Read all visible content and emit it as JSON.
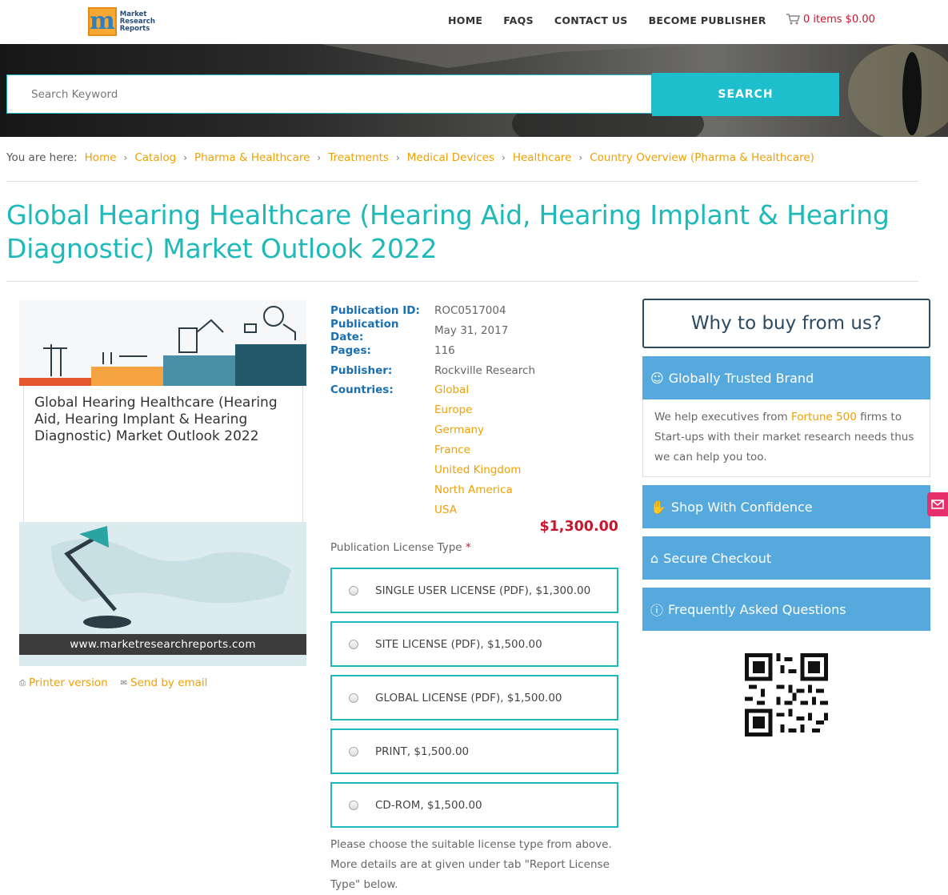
{
  "header": {
    "logo_text": [
      "Market",
      "Research",
      "Reports"
    ],
    "logo_letter": "m",
    "nav": [
      "HOME",
      "FAQS",
      "CONTACT US",
      "BECOME PUBLISHER"
    ],
    "cart": "0 items $0.00"
  },
  "search": {
    "placeholder": "Search Keyword",
    "button": "SEARCH"
  },
  "breadcrumb": {
    "prefix": "You are here:",
    "items": [
      "Home",
      "Catalog",
      "Pharma & Healthcare",
      "Treatments",
      "Medical Devices",
      "Healthcare",
      "Country Overview (Pharma & Healthcare)"
    ]
  },
  "title": "Global Hearing Healthcare (Hearing Aid, Hearing Implant & Hearing Diagnostic) Market Outlook 2022",
  "cover": {
    "title": "Global Hearing Healthcare (Hearing Aid, Hearing Implant & Hearing Diagnostic) Market Outlook 2022",
    "url": "www.marketresearchreports.com"
  },
  "tools": {
    "print": "Printer version",
    "email": "Send by email"
  },
  "details": {
    "pub_id_label": "Publication ID:",
    "pub_id": "ROC0517004",
    "pub_date_label": "Publication Date:",
    "pub_date": "May 31, 2017",
    "pages_label": "Pages:",
    "pages": "116",
    "publisher_label": "Publisher:",
    "publisher": "Rockville Research",
    "countries_label": "Countries:",
    "countries": [
      "Global",
      "Europe",
      "Germany",
      "France",
      "United Kingdom",
      "North America",
      "USA"
    ]
  },
  "price": "$1,300.00",
  "license": {
    "label": "Publication License Type",
    "required": "*",
    "options": [
      "SINGLE USER LICENSE (PDF), $1,300.00",
      "SITE LICENSE (PDF), $1,500.00",
      "GLOBAL LICENSE (PDF), $1,500.00",
      "PRINT, $1,500.00",
      "CD-ROM, $1,500.00"
    ],
    "note": "Please choose the suitable license type from above. More details are at given under tab \"Report License Type\" below."
  },
  "sidebar": {
    "why": "Why to buy from us?",
    "trusted": "Globally Trusted Brand",
    "trusted_body_1": "We help executives from ",
    "trusted_body_hl": "Fortune 500",
    "trusted_body_2": " firms to Start-ups with their market research needs thus we can help you too.",
    "confidence": "Shop With Confidence",
    "checkout": "Secure Checkout",
    "faq": "Frequently Asked Questions"
  },
  "colors": {
    "accent": "#1fb9b9",
    "link": "#f0a000",
    "price": "#c6172f",
    "panel": "#56a9dc"
  }
}
